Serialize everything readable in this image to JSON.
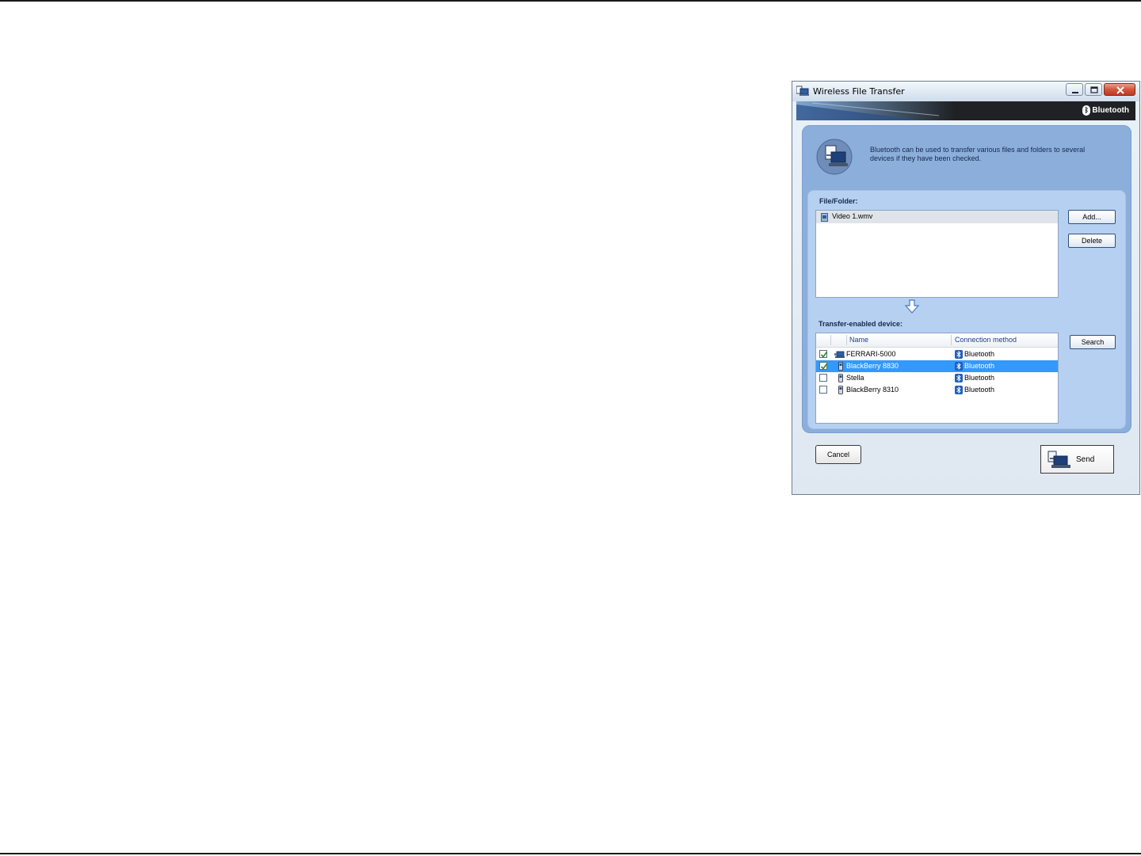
{
  "window": {
    "title": "Wireless File Transfer",
    "brand": "Bluetooth",
    "description": "Bluetooth can be used to transfer various files and folders to several devices if they have been checked."
  },
  "file_section": {
    "label": "File/Folder:",
    "files": [
      {
        "name": "Video 1.wmv"
      }
    ],
    "add_label": "Add...",
    "delete_label": "Delete"
  },
  "device_section": {
    "label": "Transfer-enabled device:",
    "columns": {
      "name": "Name",
      "connection": "Connection method"
    },
    "search_label": "Search",
    "devices": [
      {
        "name": "FERRARI-5000",
        "connection": "Bluetooth",
        "checked": true,
        "selected": false,
        "icon": "laptop-icon"
      },
      {
        "name": "BlackBerry 8830",
        "connection": "Bluetooth",
        "checked": true,
        "selected": true,
        "icon": "phone-icon"
      },
      {
        "name": "Stella",
        "connection": "Bluetooth",
        "checked": false,
        "selected": false,
        "icon": "phone-icon"
      },
      {
        "name": "BlackBerry 8310",
        "connection": "Bluetooth",
        "checked": false,
        "selected": false,
        "icon": "phone-icon"
      }
    ]
  },
  "footer": {
    "cancel_label": "Cancel",
    "send_label": "Send"
  },
  "colors": {
    "outer_panel": "#8caedb",
    "inner_panel": "#b6d0f2",
    "selection": "#3399ff",
    "header_text": "#1d3f8c"
  }
}
